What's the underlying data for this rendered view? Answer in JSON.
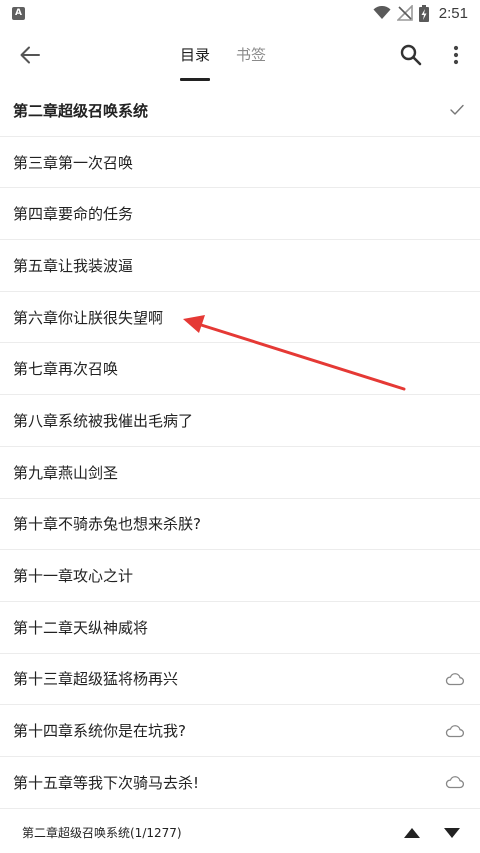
{
  "status_bar": {
    "notification_letter": "A",
    "time": "2:51",
    "icons": [
      "wifi-icon",
      "no-signal-icon",
      "battery-charging-icon"
    ]
  },
  "toolbar": {
    "back_icon": "arrow-left-icon",
    "tabs": [
      {
        "label": "目录",
        "active": true
      },
      {
        "label": "书签",
        "active": false
      }
    ],
    "search_icon": "search-icon",
    "more_icon": "more-vertical-icon"
  },
  "chapters": [
    {
      "title": "第二章超级召唤系统",
      "status": "current"
    },
    {
      "title": "第三章第一次召唤",
      "status": "downloaded"
    },
    {
      "title": "第四章要命的任务",
      "status": "downloaded"
    },
    {
      "title": "第五章让我装波逼",
      "status": "downloaded"
    },
    {
      "title": "第六章你让朕很失望啊",
      "status": "downloaded"
    },
    {
      "title": "第七章再次召唤",
      "status": "downloaded"
    },
    {
      "title": "第八章系统被我催出毛病了",
      "status": "downloaded"
    },
    {
      "title": "第九章燕山剑圣",
      "status": "downloaded"
    },
    {
      "title": "第十章不骑赤兔也想来杀朕?",
      "status": "downloaded"
    },
    {
      "title": "第十一章攻心之计",
      "status": "downloaded"
    },
    {
      "title": "第十二章天纵神威将",
      "status": "downloaded"
    },
    {
      "title": "第十三章超级猛将杨再兴",
      "status": "cloud"
    },
    {
      "title": "第十四章系统你是在坑我?",
      "status": "cloud"
    },
    {
      "title": "第十五章等我下次骑马去杀!",
      "status": "cloud"
    }
  ],
  "bottom_bar": {
    "progress": "第二章超级召唤系统(1/1277)",
    "up_icon": "triangle-up-icon",
    "down_icon": "triangle-down-icon"
  },
  "colors": {
    "annotation_arrow": "#e53935",
    "divider": "#ececec",
    "inactive_tab": "#8a8a8a"
  }
}
